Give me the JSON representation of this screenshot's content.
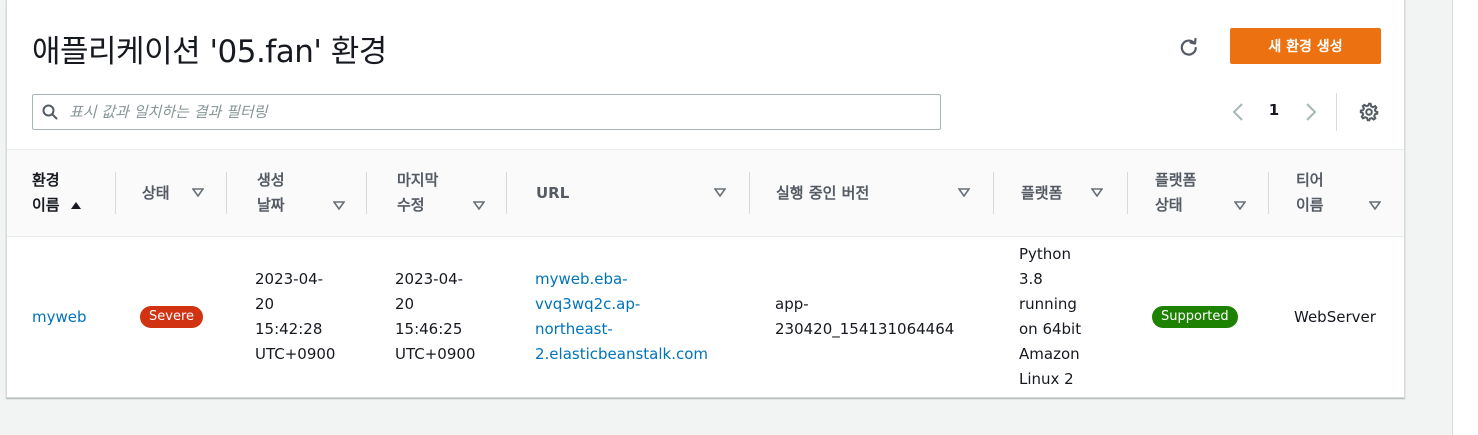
{
  "page": {
    "title": "애플리케이션 '05.fan' 환경",
    "create_button": "새 환경 생성"
  },
  "search": {
    "placeholder": "표시 값과 일치하는 결과 필터링"
  },
  "pagination": {
    "current_page": "1"
  },
  "table": {
    "columns": [
      {
        "line1": "환경",
        "line2": "이름",
        "sort_icon": "sort-ascending-icon"
      },
      {
        "line1": "상태",
        "line2": ""
      },
      {
        "line1": "생성",
        "line2": "날짜"
      },
      {
        "line1": "마지막",
        "line2": "수정"
      },
      {
        "line1": "URL",
        "line2": ""
      },
      {
        "line1": "실행 중인 버전",
        "line2": ""
      },
      {
        "line1": "플랫폼",
        "line2": ""
      },
      {
        "line1": "플랫폼",
        "line2": "상태"
      },
      {
        "line1": "티어",
        "line2": "이름"
      }
    ],
    "rows": [
      {
        "name": "myweb",
        "status": "Severe",
        "created": [
          "2023-04-",
          "20",
          "15:42:28",
          "UTC+0900"
        ],
        "modified": [
          "2023-04-",
          "20",
          "15:46:25",
          "UTC+0900"
        ],
        "url": [
          "myweb.eba-",
          "vvq3wq2c.ap-",
          "northeast-",
          "2.elasticbeanstalk.com"
        ],
        "version": [
          "app-",
          "230420_154131064464"
        ],
        "platform": [
          "Python",
          "3.8",
          "running",
          "on 64bit",
          "Amazon",
          "Linux 2"
        ],
        "platform_status": "Supported",
        "tier": "WebServer"
      }
    ]
  },
  "colors": {
    "primary": "#ec7211",
    "link": "#0073bb",
    "severe": "#d13212",
    "supported": "#1d8102"
  },
  "icons": [
    "refresh-icon",
    "search-icon",
    "chevron-left-icon",
    "chevron-right-icon",
    "gear-icon",
    "caret-down-icon",
    "sort-ascending-icon"
  ]
}
